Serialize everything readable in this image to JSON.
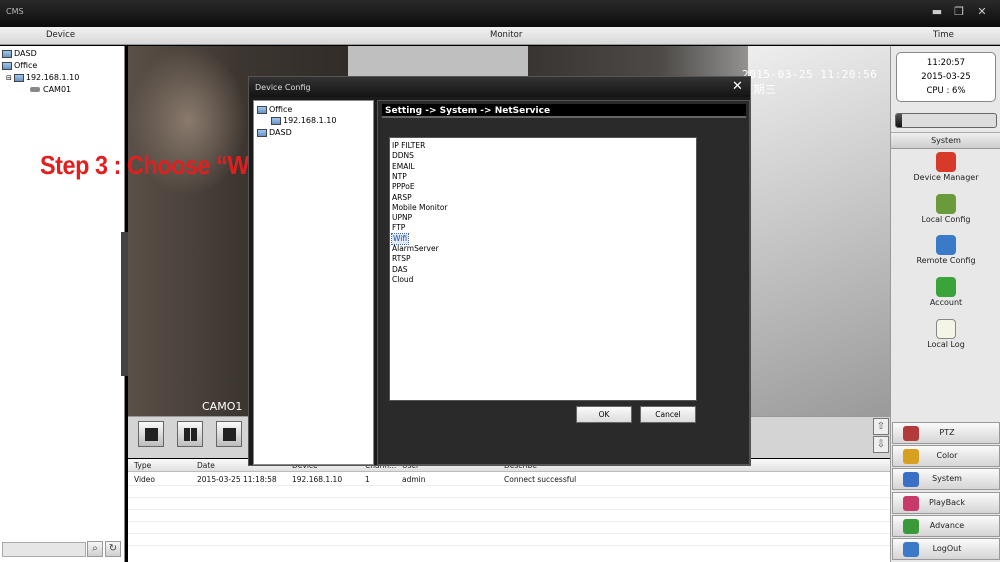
{
  "window": {
    "title": "CMS"
  },
  "header": {
    "device_label": "Device",
    "monitor_label": "Monitor",
    "time_label": "Time"
  },
  "device_tree": {
    "nodes": [
      {
        "label": "DASD"
      },
      {
        "label": "Office"
      },
      {
        "label": "192.168.1.10"
      },
      {
        "label": "CAM01"
      }
    ]
  },
  "video": {
    "osd_timestamp": "2015-03-25 11:20:56 星期三",
    "osd_channel": "CAMO1"
  },
  "annotation": {
    "step_text": "Step 3 : Choose “WI-FI”"
  },
  "clock": {
    "time": "11:20:57",
    "date": "2015-03-25",
    "cpu": "CPU : 6%",
    "cpu_fraction": 0.06
  },
  "system_panel": {
    "tab_label": "System",
    "items": [
      {
        "label": "Device Manager",
        "icon": "device-manager-icon",
        "color": "#d83a2a"
      },
      {
        "label": "Local Config",
        "icon": "local-config-icon",
        "color": "#6b9a3a"
      },
      {
        "label": "Remote Config",
        "icon": "remote-config-icon",
        "color": "#3a7bc8"
      },
      {
        "label": "Account",
        "icon": "account-icon",
        "color": "#3aa33a"
      },
      {
        "label": "Local Log",
        "icon": "local-log-icon",
        "color": "#f5f5e6"
      }
    ]
  },
  "menu": {
    "items": [
      {
        "label": "PTZ",
        "icon": "ptz-icon",
        "color": "#b23a3a"
      },
      {
        "label": "Color",
        "icon": "color-icon",
        "color": "#d8a020"
      },
      {
        "label": "System",
        "icon": "system-icon",
        "color": "#3a6fc8"
      },
      {
        "label": "PlayBack",
        "icon": "playback-icon",
        "color": "#c83a6a"
      },
      {
        "label": "Advance",
        "icon": "advance-icon",
        "color": "#3a9a3a"
      },
      {
        "label": "LogOut",
        "icon": "logout-icon",
        "color": "#3a7ac8"
      }
    ]
  },
  "log": {
    "columns": [
      "Type",
      "Date",
      "Device",
      "Chann...",
      "User",
      "Describe"
    ],
    "rows": [
      {
        "type": "Video",
        "date": "2015-03-25 11:18:58",
        "device": "192.168.1.10",
        "channel": "1",
        "user": "admin",
        "describe": "Connect successful"
      }
    ]
  },
  "dialog": {
    "title": "Device Config",
    "tree": [
      {
        "label": "Office"
      },
      {
        "label": "192.168.1.10"
      },
      {
        "label": "DASD"
      }
    ],
    "path": "Setting -> System -> NetService",
    "services": [
      "IP FILTER",
      "DDNS",
      "EMAIL",
      "NTP",
      "PPPoE",
      "ARSP",
      "Mobile Monitor",
      "UPNP",
      "FTP",
      "Wifi",
      "AlarmServer",
      "RTSP",
      "DAS",
      "Cloud"
    ],
    "selected_service": "Wifi",
    "ok_label": "OK",
    "cancel_label": "Cancel"
  }
}
